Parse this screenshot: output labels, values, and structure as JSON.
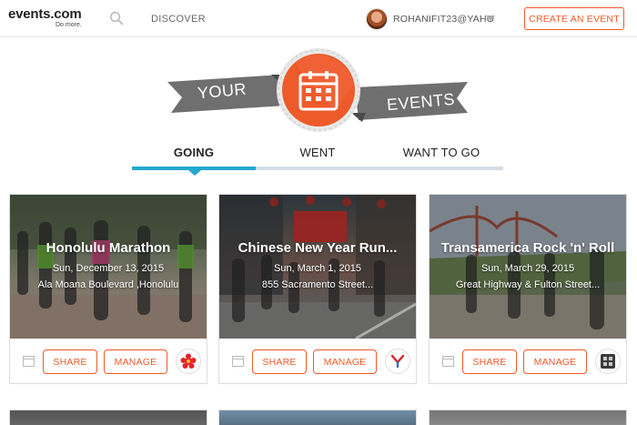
{
  "brand": {
    "logo_text": "events.com",
    "tagline": "Do more."
  },
  "nav": {
    "discover_label": "DISCOVER",
    "username": "ROHANIFIT23@YAHO",
    "create_button_label": "CREATE AN EVENT"
  },
  "hero": {
    "left_ribbon": "YOUR",
    "right_ribbon": "EVENTS",
    "icon": "calendar-icon"
  },
  "tabs": [
    {
      "label": "GOING",
      "active": true
    },
    {
      "label": "WENT",
      "active": false
    },
    {
      "label": "WANT TO GO",
      "active": false
    }
  ],
  "colors": {
    "accent_orange": "#f05a28",
    "tab_active_blue": "#22a9cf",
    "ribbon_gray": "#6f6f6f"
  },
  "events": [
    {
      "title": "Honolulu Marathon",
      "date": "Sun, December 13, 2015",
      "venue": "Ala Moana Boulevard ,Honolulu",
      "share_label": "SHARE",
      "manage_label": "MANAGE",
      "organizer_logo": "red-flower-logo"
    },
    {
      "title": "Chinese New Year Run...",
      "date": "Sun, March 1, 2015",
      "venue": "855 Sacramento Street...",
      "share_label": "SHARE",
      "manage_label": "MANAGE",
      "organizer_logo": "ymca-logo"
    },
    {
      "title": "Transamerica Rock 'n' Roll",
      "date": "Sun, March 29, 2015",
      "venue": "Great Highway & Fulton Street...",
      "share_label": "SHARE",
      "manage_label": "MANAGE",
      "organizer_logo": "building-photo-logo"
    }
  ]
}
